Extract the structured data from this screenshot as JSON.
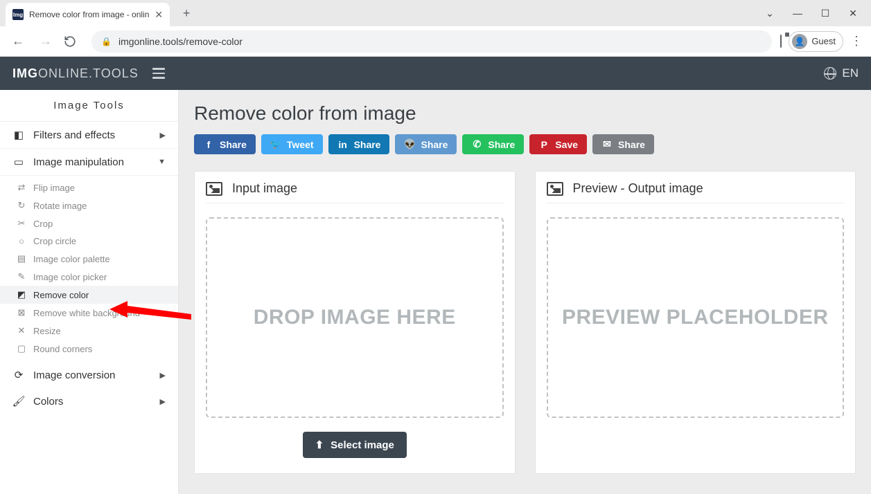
{
  "browser": {
    "tab_title": "Remove color from image - onlin",
    "url": "imgonline.tools/remove-color",
    "guest": "Guest"
  },
  "header": {
    "logo_bold": "IMG",
    "logo_rest": "ONLINE.TOOLS",
    "lang": "EN"
  },
  "sidebar": {
    "title": "Image Tools",
    "cats": {
      "filters": "Filters and effects",
      "manip": "Image manipulation",
      "conv": "Image conversion",
      "colors": "Colors"
    },
    "manip_items": [
      "Flip image",
      "Rotate image",
      "Crop",
      "Crop circle",
      "Image color palette",
      "Image color picker",
      "Remove color",
      "Remove white background",
      "Resize",
      "Round corners"
    ]
  },
  "page": {
    "title": "Remove color from image",
    "share": {
      "fb": "Share",
      "tw": "Tweet",
      "ln": "Share",
      "rd": "Share",
      "wa": "Share",
      "pn": "Save",
      "em": "Share"
    },
    "panel_input": "Input image",
    "panel_preview": "Preview - Output image",
    "drop_text": "DROP IMAGE HERE",
    "preview_text": "PREVIEW PLACEHOLDER",
    "select_btn": "Select image"
  }
}
